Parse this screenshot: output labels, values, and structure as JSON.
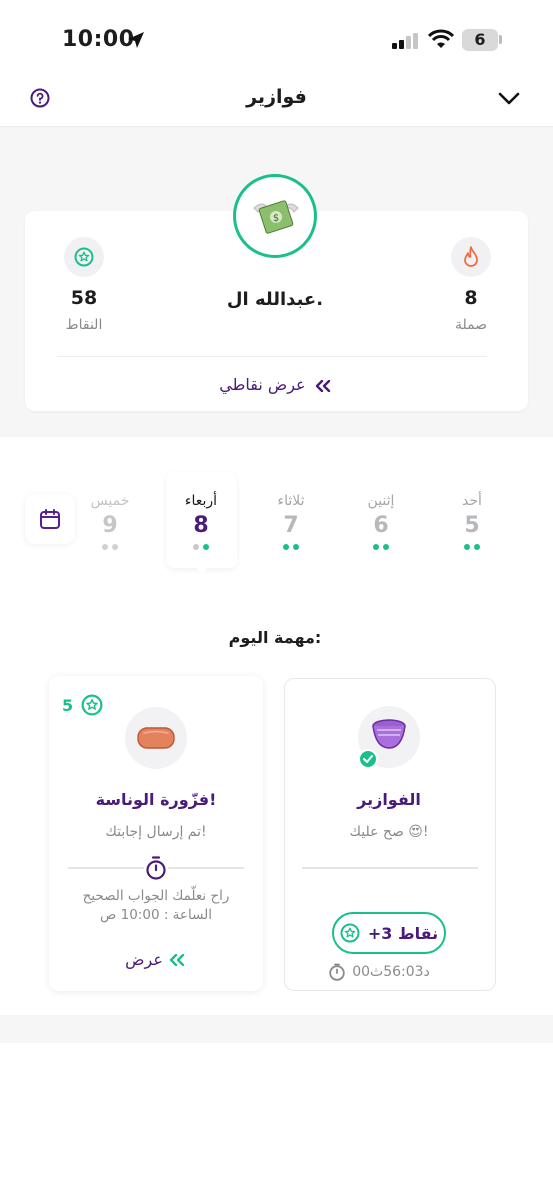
{
  "status_bar": {
    "time": "10:00",
    "battery": "6"
  },
  "header": {
    "title": "فوازير"
  },
  "profile": {
    "name": "عبدالله ال.",
    "points_value": "58",
    "points_label": "النقاط",
    "streak_value": "8",
    "streak_label": "صملة",
    "view_points": "عرض نقاطي"
  },
  "days": [
    {
      "name": "خميس",
      "number": "9",
      "dots": [
        "#d0d0d4",
        "#d0d0d4"
      ]
    },
    {
      "name": "أربعاء",
      "number": "8",
      "dots": [
        "#c9c9cd",
        "#1bbf8a"
      ],
      "active": true
    },
    {
      "name": "ثلاثاء",
      "number": "7",
      "dots": [
        "#1bbf8a",
        "#1bbf8a"
      ]
    },
    {
      "name": "إثنين",
      "number": "6",
      "dots": [
        "#1bbf8a",
        "#1bbf8a"
      ]
    },
    {
      "name": "أحد",
      "number": "5",
      "dots": [
        "#1bbf8a",
        "#1bbf8a"
      ]
    }
  ],
  "today": {
    "label": "مهمة اليوم:"
  },
  "tasks": {
    "riddles": {
      "title": "الفوازير",
      "subtitle": "صح عليك 😍!",
      "points_pill": "+3 نقاط",
      "timer": "00د56:03ث"
    },
    "fun_riddle": {
      "badge": "5",
      "title": "فزّورة الوناسة!",
      "subtitle": "تم إرسال إجابتك!",
      "reveal_line1": "راح نعلّمك الجواب الصحيح",
      "reveal_line2": "الساعة : 10:00 ص",
      "view": "عرض"
    }
  },
  "colors": {
    "accent": "#1bbf8a",
    "brand": "#4a1b7a",
    "muted": "#8a8a8e"
  }
}
